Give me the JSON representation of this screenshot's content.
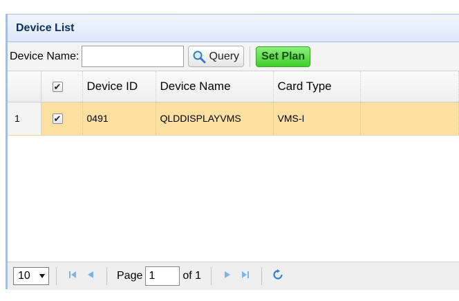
{
  "panel": {
    "title": "Device List"
  },
  "toolbar": {
    "device_name_label": "Device Name:",
    "device_name_value": "",
    "query_label": "Query",
    "set_plan_label": "Set Plan"
  },
  "grid": {
    "columns": [
      "Device ID",
      "Device Name",
      "Card Type"
    ],
    "rows": [
      {
        "row_number": "1",
        "checked": true,
        "device_id": "0491",
        "device_name": "QLDDISPLAYVMS",
        "card_type": "VMS-I"
      }
    ],
    "check_mark": "✔"
  },
  "pager": {
    "page_size": "10",
    "page_label": "Page",
    "current_page": "1",
    "of_label": "of 1"
  },
  "colors": {
    "selected_row": "#fbe0a1",
    "set_plan_button": "#3ecf28",
    "header_background": "#dde9fa"
  }
}
